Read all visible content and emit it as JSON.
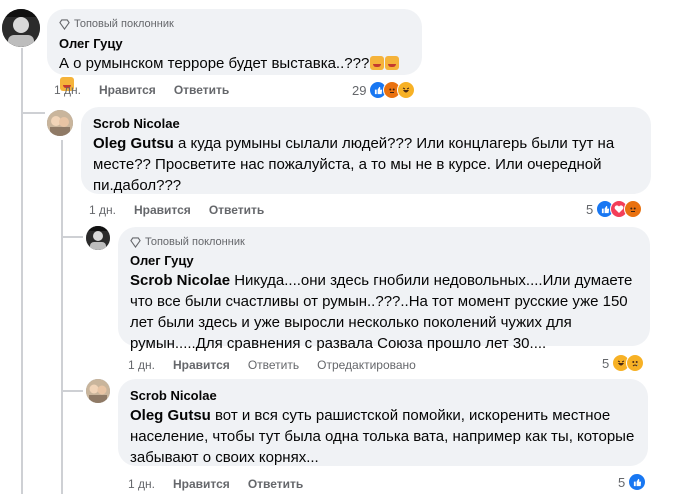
{
  "colors": {
    "bubble": "#f0f2f5",
    "muted": "#65676b",
    "like": "#1877f2",
    "love": "#f33e58",
    "angry": "#e9710f",
    "haha": "#f7b125"
  },
  "comments": [
    {
      "badge": "Топовый поклонник",
      "author": "Олег Гуцу",
      "text": "А о румынском терроре будет выставка..???",
      "inline_emojis": [
        "clown-emoji",
        "clown-emoji",
        "clown-emoji"
      ],
      "time": "1 дн.",
      "like_label": "Нравится",
      "reply_label": "Ответить",
      "reaction_count": "29",
      "reactions": [
        "like-icon",
        "angry-icon",
        "haha-icon"
      ]
    },
    {
      "author": "Scrob Nicolae",
      "mention": "Oleg Gutsu",
      "text": " а куда румыны сылали людей??? Или концлагерь были тут на месте?? Просветите нас пожалуйста, а то мы не в курсе. Или очередной пи.дабол???",
      "time": "1 дн.",
      "like_label": "Нравится",
      "reply_label": "Ответить",
      "reaction_count": "5",
      "reactions": [
        "like-icon",
        "love-icon",
        "angry-icon"
      ]
    },
    {
      "badge": "Топовый поклонник",
      "author": "Олег Гуцу",
      "mention": "Scrob Nicolae",
      "text": " Никуда....они здесь гнобили недовольных....Или думаете что все были счастливы от румын..???..На тот момент русские уже 150 лет были здесь и уже выросли несколько поколений чужих для румын.....Для сравнения с развала Союза прошло лет 30....",
      "time": "1 дн.",
      "like_label": "Нравится",
      "reply_label": "Ответить",
      "edited_label": "Отредактировано",
      "reaction_count": "5",
      "reactions": [
        "haha-icon",
        "sad-icon"
      ]
    },
    {
      "author": "Scrob Nicolae",
      "mention": "Oleg Gutsu",
      "text": " вот и вся суть рашистской помойки, искоренить местное население, чтобы тут была одна толька вата, например как ты, которые забывают о своих корнях...",
      "time": "1 дн.",
      "like_label": "Нравится",
      "reply_label": "Ответить",
      "reaction_count": "5",
      "reactions": [
        "like-icon"
      ]
    }
  ]
}
